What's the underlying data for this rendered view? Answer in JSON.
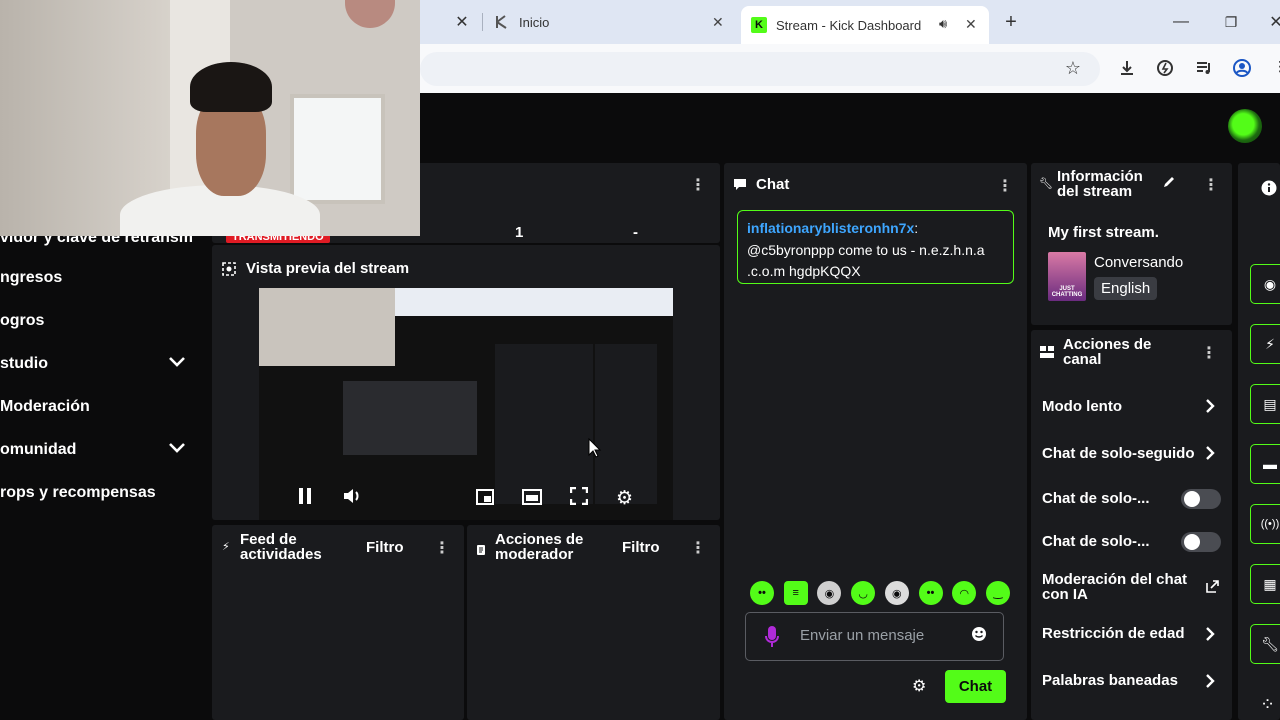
{
  "browser": {
    "tabs": [
      {
        "label": ""
      },
      {
        "label": "Inicio"
      },
      {
        "label": "Stream - Kick Dashboard"
      }
    ],
    "new_tab": "+"
  },
  "sidebar": {
    "partial_title": "vidor y clave de retransm",
    "badge": "TRANSMITIENDO",
    "items": [
      {
        "label": "ngresos",
        "chevron": false
      },
      {
        "label": "ogros",
        "chevron": false
      },
      {
        "label": "studio",
        "chevron": true
      },
      {
        "label": "Moderación",
        "chevron": false
      },
      {
        "label": "omunidad",
        "chevron": true
      },
      {
        "label": "rops y recompensas",
        "chevron": false
      }
    ]
  },
  "stats": {
    "a": "-",
    "b": "1",
    "c": "-"
  },
  "preview": {
    "title": "Vista previa del stream"
  },
  "feed": {
    "title_l1": "Feed de",
    "title_l2": "actividades",
    "filter": "Filtro"
  },
  "modactions": {
    "title_l1": "Acciones de",
    "title_l2": "moderador",
    "filter": "Filtro"
  },
  "chat": {
    "title": "Chat",
    "message": {
      "user": "inflationaryblisteronhn7x",
      "colon": ":",
      "line1": "@c5byronppp come to us - n.e.z.h.n.a",
      "line2": ".c.o.m hgdpKQQX"
    },
    "input_placeholder": "Enviar un mensaje",
    "send_label": "Chat"
  },
  "info": {
    "title_l1": "Información",
    "title_l2": "del stream",
    "stream_title": "My first stream.",
    "category": "Conversando",
    "language": "English",
    "thumb_text": "JUST CHATTING"
  },
  "channel": {
    "title_l1": "Acciones de",
    "title_l2": "canal",
    "rows": [
      {
        "label": "Modo lento"
      },
      {
        "label": "Chat de solo-seguido"
      },
      {
        "label": "Chat de solo-..."
      },
      {
        "label": "Chat de solo-..."
      },
      {
        "label": "Moderación del chat",
        "label2": "con IA"
      },
      {
        "label": "Restricción de edad"
      },
      {
        "label": "Palabras baneadas"
      }
    ]
  },
  "colors": {
    "accent": "#53fc18",
    "live": "#e01b24",
    "username": "#3ea6ff"
  }
}
